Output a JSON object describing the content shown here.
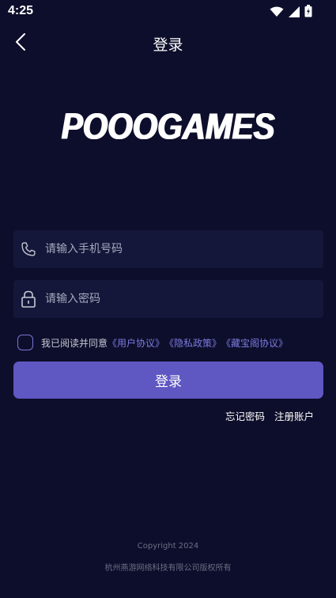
{
  "status_bar": {
    "time": "4:25"
  },
  "app_bar": {
    "title": "登录"
  },
  "logo": {
    "text": "POOOGAMES"
  },
  "phone_input": {
    "placeholder": "请输入手机号码",
    "value": ""
  },
  "password_input": {
    "placeholder": "请输入密码",
    "value": ""
  },
  "agreement": {
    "prefix": "我已阅读并同意",
    "user_agreement": "《用户协议》",
    "privacy_policy": "《隐私政策》",
    "treasure_agreement": "《藏宝阁协议》"
  },
  "login_button": {
    "label": "登录"
  },
  "links": {
    "forgot_password": "忘记密码",
    "register": "注册账户"
  },
  "footer": {
    "copyright": "Copyright 2024",
    "company": "杭州燕游网络科技有限公司版权所有"
  },
  "icons": {
    "back": "chevron-left-icon",
    "phone": "phone-icon",
    "lock": "lock-icon",
    "wifi": "wifi-icon",
    "signal": "signal-icon",
    "battery": "battery-icon"
  },
  "colors": {
    "background": "#0d0e2b",
    "field": "#15173a",
    "primary": "#5f57c2",
    "link": "#7d7ae0"
  }
}
